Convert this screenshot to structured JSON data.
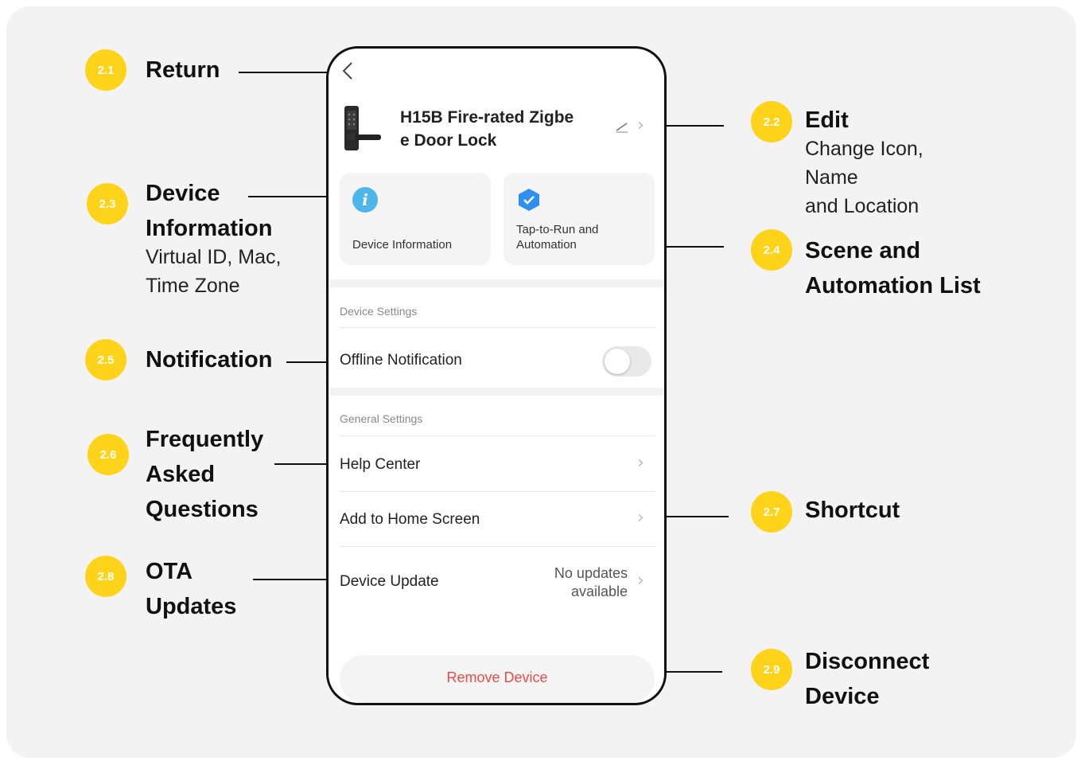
{
  "annotations": {
    "return": {
      "badge": "2.1",
      "title": "Return"
    },
    "edit": {
      "badge": "2.2",
      "title": "Edit",
      "subtitle": [
        "Change Icon,",
        "Name",
        "and Location"
      ]
    },
    "device_info": {
      "badge": "2.3",
      "title": [
        "Device",
        "Information"
      ],
      "subtitle": [
        "Virtual ID, Mac,",
        "Time Zone"
      ]
    },
    "scene": {
      "badge": "2.4",
      "title": [
        "Scene and",
        "Automation List"
      ]
    },
    "notification": {
      "badge": "2.5",
      "title": "Notification"
    },
    "faq": {
      "badge": "2.6",
      "title": [
        "Frequently",
        "Asked",
        "Questions"
      ]
    },
    "shortcut": {
      "badge": "2.7",
      "title": "Shortcut"
    },
    "ota": {
      "badge": "2.8",
      "title": [
        "OTA",
        "Updates"
      ]
    },
    "disconnect": {
      "badge": "2.9",
      "title": [
        "Disconnect",
        "Device"
      ]
    }
  },
  "phone": {
    "device_name": [
      "H15B Fire-rated Zigbe",
      "e Door Lock"
    ],
    "cards": {
      "device_info": "Device Information",
      "tap_to_run": [
        "Tap-to-Run and",
        "Automation"
      ]
    },
    "device_settings": {
      "title": "Device Settings",
      "offline_notification": "Offline Notification",
      "offline_notification_enabled": false
    },
    "general_settings": {
      "title": "General Settings",
      "help_center": "Help Center",
      "add_to_home": "Add to Home Screen",
      "device_update": "Device Update",
      "update_status": [
        "No updates",
        "available"
      ]
    },
    "remove_device": "Remove Device"
  },
  "colors": {
    "badge": "#ffd31a",
    "background": "#f3f3f3",
    "info_icon": "#4fb6ec",
    "remove_text": "#ee4a4a"
  },
  "icons": [
    "back-arrow-icon",
    "door-lock-thumbnail",
    "pencil-edit-icon",
    "chevron-right-icon",
    "info-icon",
    "shield-check-icon"
  ]
}
